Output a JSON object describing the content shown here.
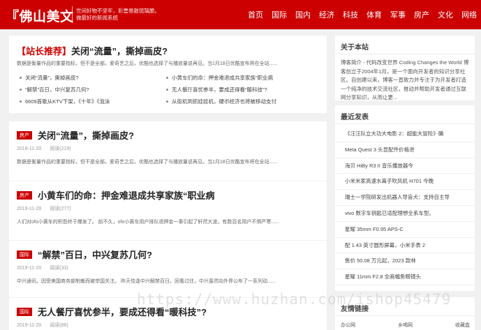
{
  "header": {
    "logo": "『佛山美文",
    "slogan_line1": "世间好物不坚牢，彩雲易散琉璃脆。",
    "slogan_line2": "做最好的新闻系统",
    "nav": [
      "首页",
      "国际",
      "国内",
      "经济",
      "科技",
      "体育",
      "军事",
      "房产",
      "文化",
      "网络"
    ]
  },
  "featured": {
    "tag": "【站长推荐】",
    "title": "关闭“流量”，撕掉画皮?",
    "desc": "数据是衡量作品的重要指标，但不是全部。爱奇艺之后，优酷也选择了与播放量说再见。当1月18日优酷宣布将在全站......",
    "links": [
      "关闭“流量”，撕掉画皮?",
      "小黄车们的命：押金难退成共享家族“职业病",
      "“解禁”百日，中兴复苏几何?",
      "无人餐厅喜忧参半，要成还得看“暖科技”?",
      "6609首歌从KTV下架，《十年》《泡沫",
      "从街机到抓娃娃机，硬币经济也将被移动支付"
    ]
  },
  "posts": [
    {
      "badge": "房产",
      "title": "关闭“流量”，撕掉画皮?",
      "date": "2019-11-20",
      "views": "阅读(219)",
      "excerpt": "数据是衡量作品的重要指标，但不是全部。爱奇艺之后，优酷也选择了与播放量说再见。当1月18日优酷宣布将在全站......"
    },
    {
      "badge": "房产",
      "title": "小黄车们的命：押金难退成共享家族“职业病",
      "date": "2019-11-20",
      "views": "阅读(277)",
      "excerpt": "人们对ofo小黄车的积怨终于爆发了。 前不久，ofo小黄车用户排队退押金一事引起了轩然大波。有数百名用户不惧严寒......"
    },
    {
      "badge": "国际",
      "title": "“解禁”百日，中兴复苏几何?",
      "date": "2019-11-20",
      "views": "阅读(33)",
      "excerpt": "中兴通讯。因受美国商务部制裁而被举国关注。 昨天恰逢中兴解禁百日。回看过往，中兴虽然向外界公布了一系列动......"
    },
    {
      "badge": "国际",
      "title": "无人餐厅喜忧参半，要成还得看“暖科技”?",
      "date": "2019-11-20",
      "views": "阅读(86)",
      "excerpt": ""
    }
  ],
  "about": {
    "title": "关于本站",
    "text": "博客简介 - 代码改变世界 Coding Changes the World 博客创立于2004年1月，是一个面向开发者的知识分享社区。自创建以来，博客一直致力并专注于为开发者打造一个纯净的技术交流社区，推动并帮助开发者通过互联网分享知识，从而让更..."
  },
  "recent": {
    "title": "最近发表",
    "items": [
      "《汪汪队立大功大电影 2：超能大冒险》确",
      "Meta Quest 3 头显配件价格泄",
      "海贝 HiBy R3 II 音乐播放器今",
      "小米米家高速水离子吹风机 H701 今晚",
      "瑞士一学院研发出机器人导盲犬：支持自主导",
      "vivo 数字车钥匙已适配理想全系车型。",
      "星曜 35mm F0.95 APS-C",
      "配 1.43 英寸圆形屏幕，小米手表 2",
      "售价 50.08 万元起，2023 款林",
      "星曜 11mm F2.8 全画幅鱼眼镜头"
    ]
  },
  "friend_links": {
    "title": "友情链接",
    "items": [
      "办公网",
      "乡喝网",
      "收藏盒"
    ]
  },
  "watermark": "https://www.huzhan.com/ishop45479"
}
